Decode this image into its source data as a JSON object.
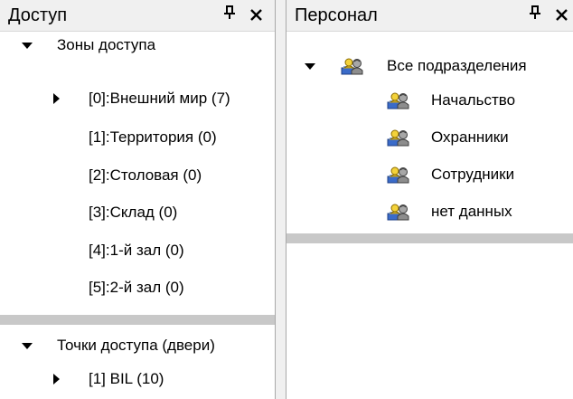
{
  "access": {
    "title": "Доступ",
    "pin_glyph": "ᐁ",
    "close_glyph": "✕",
    "zones_label": "Зоны доступа",
    "zones": [
      {
        "label": "[0]:Внешний мир (7)",
        "expandable": true
      },
      {
        "label": "[1]:Территория (0)",
        "expandable": false
      },
      {
        "label": "[2]:Столовая (0)",
        "expandable": false
      },
      {
        "label": "[3]:Склад (0)",
        "expandable": false
      },
      {
        "label": "[4]:1-й зал (0)",
        "expandable": false
      },
      {
        "label": "[5]:2-й зал (0)",
        "expandable": false
      }
    ],
    "points_label": "Точки доступа (двери)",
    "points": [
      {
        "label": "[1] BIL (10)",
        "expandable": true
      }
    ]
  },
  "staff": {
    "title": "Персонал",
    "root_label": "Все подразделения",
    "departments": [
      {
        "label": "Начальство"
      },
      {
        "label": "Охранники"
      },
      {
        "label": "Сотрудники"
      },
      {
        "label": "нет данных"
      }
    ]
  },
  "icons": {
    "group_icon": "people-group-icon"
  }
}
